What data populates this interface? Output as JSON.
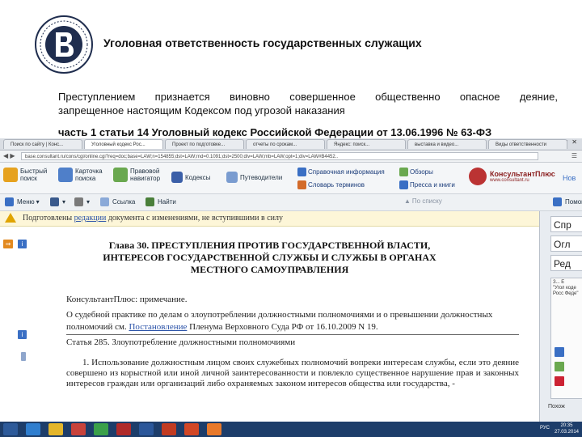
{
  "slide": {
    "title": "Уголовная ответственность государственных служащих",
    "definition_words": [
      "Преступлением",
      "признается",
      "виновно",
      "совершенное",
      "общественно",
      "опасное",
      "деяние,"
    ],
    "definition_line2": "запрещенное настоящим Кодексом под угрозой наказания",
    "reference": "часть 1 статьи 14 Уголовный кодекс Российской Федерации от 13.06.1996 № 63-ФЗ"
  },
  "browser": {
    "tabs": [
      "Поиск по сайту | Конс...",
      "Уголовный кодекс Рос...",
      "Проект по подготовке...",
      "отчеты по срокам...",
      "Яндекс: поиск...",
      "выставка и видео...",
      "Виды ответственности"
    ],
    "url": "base.consultant.ru/cons/cgi/online.cgi?req=doc;base=LAW;n=154855;dst=LAW;rnd=0.1091;dst=2500;div=LAW;mb=LAW;opt=1;div=LAW#B4452..",
    "toolbar": {
      "quick_search": "Быстрый поиск",
      "card_search": "Карточка поиска",
      "legal_navigator": "Правовой навигатор",
      "codes": "Кодексы",
      "guides": "Путеводители",
      "reference_info": "Справочная информация",
      "terms_dictionary": "Словарь терминов",
      "reviews": "Обзоры",
      "press_books": "Пресса и книги",
      "brand": "КонсультантПлюс",
      "brand_sub": "www.consultant.ru",
      "new": "Нов"
    },
    "toolbar2": {
      "menu": "Меню",
      "link": "Ссылка",
      "find": "Найти",
      "search_placeholder": "По списку",
      "help": "Помощь"
    },
    "notice": {
      "prefix": "Подготовлены ",
      "link": "редакции",
      "suffix": " документа с изменениями, не вступившими в силу"
    },
    "chapter_lines": [
      "Глава 30. ПРЕСТУПЛЕНИЯ ПРОТИВ ГОСУДАРСТВЕННОЙ ВЛАСТИ,",
      "ИНТЕРЕСОВ ГОСУДАРСТВЕННОЙ СЛУЖБЫ И СЛУЖБЫ В ОРГАНАХ",
      "МЕСТНОГО САМОУПРАВЛЕНИЯ"
    ],
    "note_heading": "КонсультантПлюс: примечание.",
    "note_text_a": "О судебной практике по делам о злоупотреблении должностными полномочиями и о превышении должностных полномочий см. ",
    "note_link": "Постановление",
    "note_text_b": " Пленума Верховного Суда РФ от 16.10.2009 N 19.",
    "article_title": "Статья 285. Злоупотребление должностными полномочиями",
    "paragraph1": "1. Использование должностным лицом своих служебных полномочий вопреки интересам службы, если это деяние совершено из корыстной или иной личной заинтересованности и повлекло существенное нарушение прав и законных интересов граждан или организаций либо охраняемых законом интересов общества или государства, -",
    "right_panel": [
      "Спр",
      "Огл",
      "Ред"
    ],
    "right_box": "З... Е\n\"Угол коде Росс Феде\"",
    "right_bottom": "Похож",
    "taskbar": {
      "lang": "РУС",
      "time": "20:35",
      "date": "27.03.2014"
    }
  },
  "colors": {
    "accent": "#3a6fc4",
    "notice_bg": "#fdf6d8",
    "taskbar": "#1d3d6a"
  }
}
